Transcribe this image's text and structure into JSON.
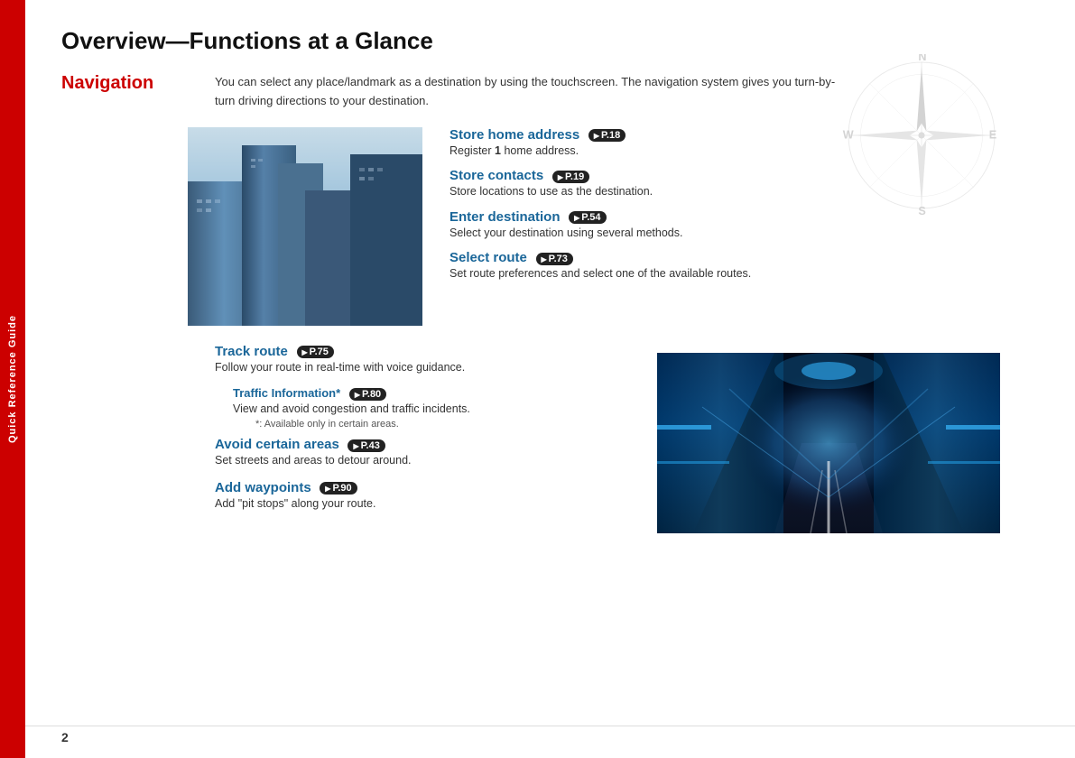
{
  "sidebar": {
    "label": "Quick Reference Guide"
  },
  "page": {
    "title": "Overview—Functions at a Glance",
    "number": "2"
  },
  "navigation": {
    "label": "Navigation",
    "description": "You can select any place/landmark as a destination by using the touchscreen. The navigation system gives you turn-by-turn driving directions to your destination."
  },
  "features_top": [
    {
      "title": "Store home address",
      "badge": "P.18",
      "description": "Register 1 home address."
    },
    {
      "title": "Store contacts",
      "badge": "P.19",
      "description": "Store locations to use as the destination."
    },
    {
      "title": "Enter destination",
      "badge": "P.54",
      "description": "Select your destination using several methods."
    },
    {
      "title": "Select route",
      "badge": "P.73",
      "description": "Set route preferences and select one of the available routes."
    }
  ],
  "features_bottom": [
    {
      "title": "Track route",
      "badge": "P.75",
      "description": "Follow your route in real-time with voice guidance.",
      "sub": {
        "title": "Traffic Information*",
        "badge": "P.80",
        "description": "View and avoid congestion and traffic incidents.",
        "note": "*: Available only in certain areas."
      }
    },
    {
      "title": "Avoid certain areas",
      "badge": "P.43",
      "description": "Set streets and areas to detour around."
    },
    {
      "title": "Add waypoints",
      "badge": "P.90",
      "description": "Add “pit stops” along your route."
    }
  ]
}
